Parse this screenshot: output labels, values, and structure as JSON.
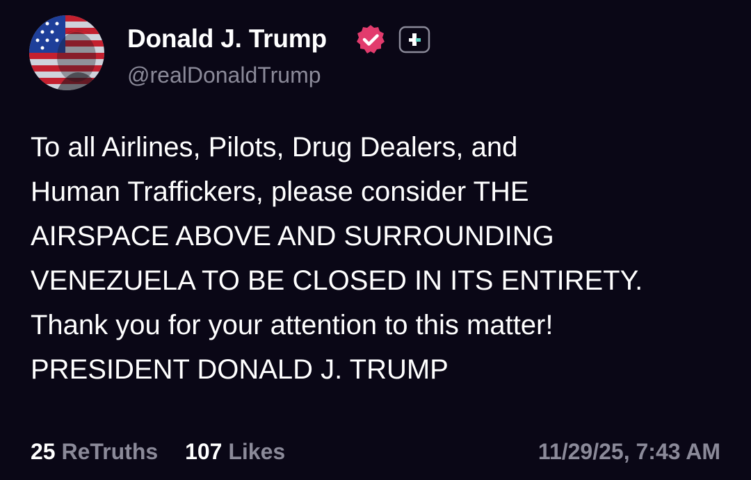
{
  "author": {
    "display_name": "Donald J. Trump",
    "handle": "@realDonaldTrump",
    "avatar": "avatar-portrait-american-flag",
    "verified_icon": "verified-badge-icon",
    "follow_icon": "plus-icon"
  },
  "post": {
    "lines": [
      "To all Airlines, Pilots, Drug Dealers, and",
      "Human Traffickers, please consider THE",
      "AIRSPACE ABOVE AND SURROUNDING",
      "VENEZUELA TO BE CLOSED IN ITS ENTIRETY.",
      "Thank you for your attention to this matter!",
      "PRESIDENT DONALD J. TRUMP"
    ]
  },
  "footer": {
    "retruths_count": "25",
    "retruths_label": "ReTruths",
    "likes_count": "107",
    "likes_label": "Likes",
    "timestamp": "11/29/25, 7:43 AM"
  },
  "colors": {
    "background": "#0a0716",
    "text": "#ffffff",
    "muted": "#8b8a99",
    "verified_badge": "#e23b6d"
  }
}
